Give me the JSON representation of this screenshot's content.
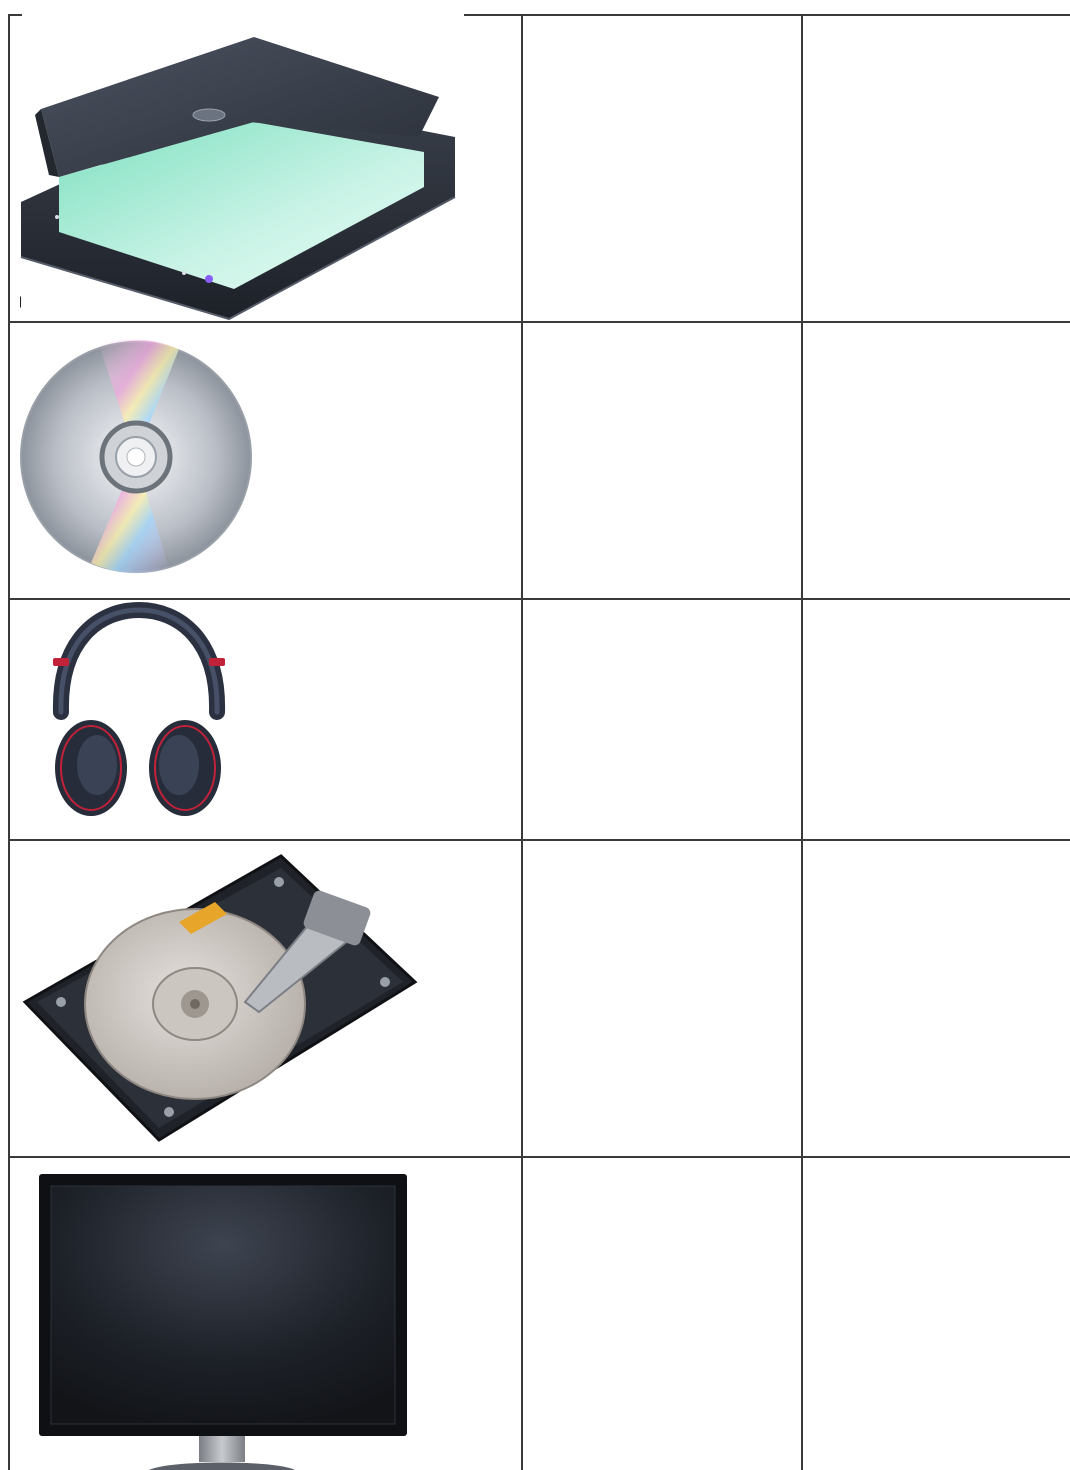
{
  "worksheet": {
    "rows": [
      {
        "device": "flatbed-scanner"
      },
      {
        "device": "optical-disc"
      },
      {
        "device": "headphones"
      },
      {
        "device": "hard-disk-drive"
      },
      {
        "device": "monitor"
      }
    ],
    "colors": {
      "grid_line": "#3a3a3a",
      "background": "#ffffff"
    }
  }
}
